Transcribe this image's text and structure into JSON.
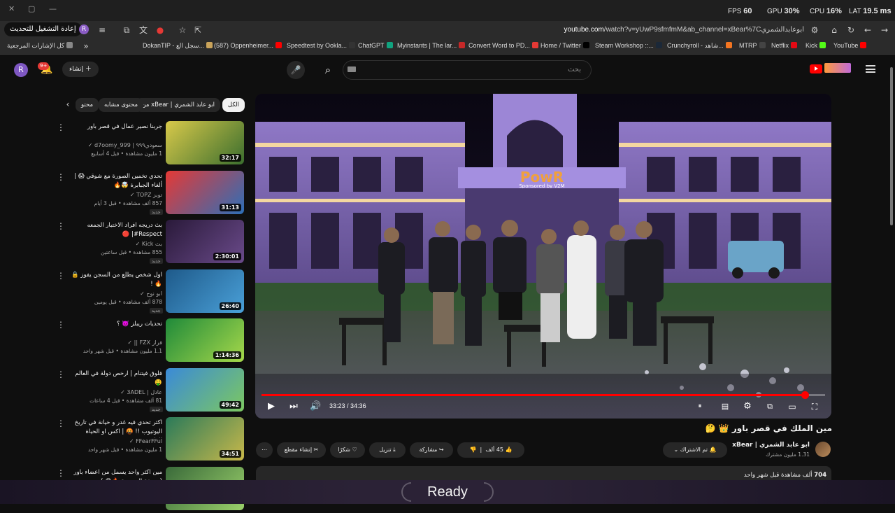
{
  "browser": {
    "reload_chip": "إعادة التشغيل للتحديث",
    "profile_initial": "R",
    "url_host": "youtube.com",
    "url_rest": "/watch?v=yUwP9sfmfmM&ab_channel=xBear%7Cابوعابدالشمري",
    "overlay": {
      "fps_label": "FPS",
      "fps_value": "60",
      "gpu_label": "GPU",
      "gpu_value": "30%",
      "cpu_label": "CPU",
      "cpu_value": "16%",
      "lat_label": "LAT",
      "lat_value": "19.5 ms"
    },
    "bookmarks": [
      {
        "label": "كل الإشارات المرجعية",
        "color": "#888888"
      },
      {
        "label": "DokanTIP - سجل الع...",
        "color": "#c9a35a"
      },
      {
        "label": "(587) Oppenheimer...",
        "color": "#ff0000"
      },
      {
        "label": "Speedtest by Ookla...",
        "color": "#333333"
      },
      {
        "label": "ChatGPT",
        "color": "#10a37f"
      },
      {
        "label": "Myinstants | The lar...",
        "color": "#c62828"
      },
      {
        "label": "Convert Word to PD...",
        "color": "#e53935"
      },
      {
        "label": "Home / Twitter",
        "color": "#000000"
      },
      {
        "label": "Steam Workshop ::...",
        "color": "#1b2838"
      },
      {
        "label": "Crunchyroll - شاهد...",
        "color": "#f47521"
      },
      {
        "label": "MTRP",
        "color": "#444444"
      },
      {
        "label": "Netflix",
        "color": "#e50914"
      },
      {
        "label": "Kick",
        "color": "#53fc18"
      },
      {
        "label": "YouTube",
        "color": "#ff0000"
      }
    ]
  },
  "masthead": {
    "avatar_initial": "R",
    "notification_count": "9+",
    "create_label": "إنشاء",
    "search_placeholder": "بحث"
  },
  "chips": [
    {
      "label": "الكل",
      "active": true
    },
    {
      "label": "من xBear | ابو عابد الشمري",
      "active": false
    },
    {
      "label": "محتوى مشابه",
      "active": false
    },
    {
      "label": "محتو",
      "active": false
    }
  ],
  "recommendations": [
    {
      "title": "جربنا نصير عمال في قصر باور",
      "channel": "سعودي٩٩٩ | d7oomy_999",
      "meta": "1 مليون مشاهدة • قبل 4 أسابيع",
      "duration": "32:17",
      "new": false,
      "thumb": [
        "#d8c94a",
        "#3b6e2e"
      ]
    },
    {
      "title": "تحدي تخمين الصورة مع شوقي 😱 | ألغاء الجبابرة 🤯🔥",
      "channel": "توبز TOPZ",
      "meta": "857 ألف مشاهدة • قبل 3 أيام",
      "duration": "31:13",
      "new": true,
      "thumb": [
        "#e53935",
        "#2d6fb8"
      ]
    },
    {
      "title": "بث دريجه افراد الاختبار الجمعه Respect#| 🔴",
      "channel": "بث Kick",
      "meta": "855 مشاهدة • قبل ساعتين",
      "duration": "2:30:01",
      "new": true,
      "thumb": [
        "#2a1a3a",
        "#6a4a8a"
      ]
    },
    {
      "title": "اول شخص يطلع من السجن يفوز 🔒🔥 !",
      "channel": "ابو نوح",
      "meta": "878 ألف مشاهدة • قبل يومين",
      "duration": "26:40",
      "new": true,
      "thumb": [
        "#1e5a8a",
        "#4aa0d8"
      ]
    },
    {
      "title": "تحديات ريبلز 👿 ؟",
      "channel": "فراز FZX ||",
      "meta": "1.1 مليون مشاهدة • قبل شهر واحد",
      "duration": "1:14:36",
      "new": false,
      "thumb": [
        "#1f8a3a",
        "#a6d84a"
      ]
    },
    {
      "title": "فلوق فيتنام | ارخص دولة في العالم🤑",
      "channel": "عادل | 3ADEL",
      "meta": "81 ألف مشاهدة • قبل 4 ساعات",
      "duration": "49:42",
      "new": true,
      "thumb": [
        "#3a8ad8",
        "#7cc860"
      ]
    },
    {
      "title": "اكثر تحدي فيه غدر و خيانة في تاريخ اليوتيوب !! 🤬 | اكس او الحياة الواقعية ...",
      "channel": "FFearFFul",
      "meta": "1 مليون مشاهدة • قبل شهر واحد",
      "duration": "34:51",
      "new": false,
      "thumb": [
        "#2a7a5a",
        "#c8b84a"
      ]
    },
    {
      "title": "مين اكثر واحد يسمل من اعضاء باور ( نسخة المدرسة 🔥😂 )",
      "channel": "",
      "meta": "",
      "duration": "",
      "new": false,
      "thumb": [
        "#3a6a3a",
        "#9ad06a"
      ]
    }
  ],
  "player": {
    "time_current": "33:23",
    "time_total": "34:36",
    "progress": 0.9645,
    "sign_text": "PowR",
    "sign_sub": "Sponsored by V2M"
  },
  "watch": {
    "title": "مين الملك في قصر باور 👑 🤔",
    "channel_name": "ابو عابد الشمري | xBear",
    "channel_subs": "1.31 مليون مشترك",
    "subscribed_label": "تم الاشتراك",
    "likes": "45 ألف",
    "share_label": "مشاركة",
    "download_label": "تنزيل",
    "thanks_label": "شكرًا",
    "clip_label": "إنشاء مقطع",
    "views": "704",
    "views_suffix": "ألف مشاهدة  قبل شهر واحد"
  },
  "status": {
    "ready": "Ready"
  },
  "colors": {
    "accent": "#ff0000",
    "background": "#0f0f0f",
    "chip": "#272727"
  }
}
